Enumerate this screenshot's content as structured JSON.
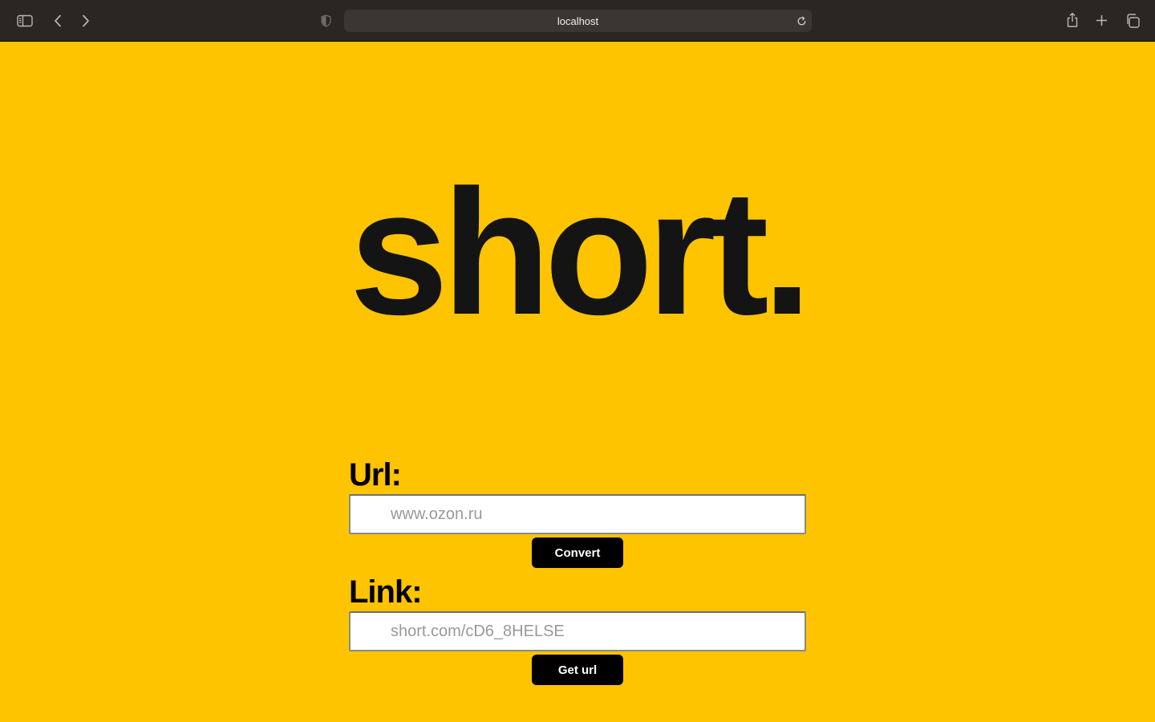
{
  "browser": {
    "address": "localhost",
    "icons": {
      "sidebar": "sidebar-icon",
      "back": "chevron-left-icon",
      "forward": "chevron-right-icon",
      "privacy": "shield-icon",
      "reload": "reload-icon",
      "share": "share-icon",
      "new_tab": "plus-icon",
      "tabs": "tabs-overview-icon"
    }
  },
  "page": {
    "background": "#FEC400",
    "logo": "short.",
    "url_section": {
      "label": "Url:",
      "placeholder": "www.ozon.ru",
      "button": "Convert"
    },
    "link_section": {
      "label": "Link:",
      "placeholder": "short.com/cD6_8HELSE",
      "button": "Get url"
    }
  }
}
